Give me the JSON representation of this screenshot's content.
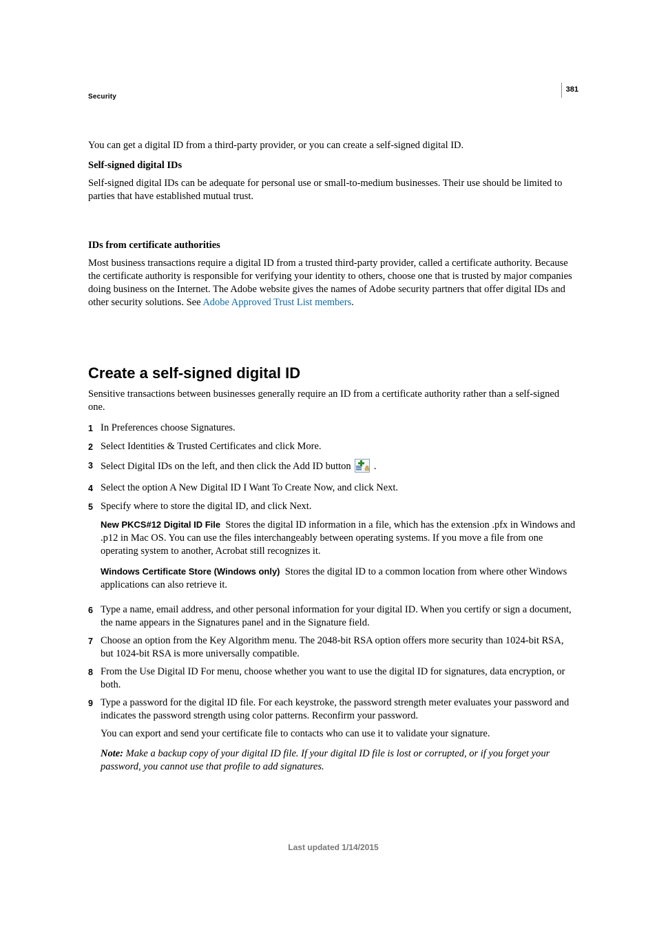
{
  "page_number": "381",
  "running_head": "Security",
  "intro_paragraph": "You can get a digital ID from a third-party provider, or you can create a self-signed digital ID.",
  "section_self_signed": {
    "title": "Self-signed digital IDs",
    "body": "Self-signed digital IDs can be adequate for personal use or small-to-medium businesses. Their use should be limited to parties that have established mutual trust."
  },
  "section_cert_auth": {
    "title": "IDs from certificate authorities",
    "body_before_link": "Most business transactions require a digital ID from a trusted third-party provider, called a certificate authority. Because the certificate authority is responsible for verifying your identity to others, choose one that is trusted by major companies doing business on the Internet. The Adobe website gives the names of Adobe security partners that offer digital IDs and other security solutions. See ",
    "link_text": "Adobe Approved Trust List members",
    "body_after_link": "."
  },
  "h2": "Create a self-signed digital ID",
  "h2_intro": "Sensitive transactions between businesses generally require an ID from a certificate authority rather than a self-signed one.",
  "steps": {
    "s1": "In Preferences choose Signatures.",
    "s2": "Select Identities & Trusted Certificates and click More.",
    "s3_before": "Select Digital IDs on the left, and then click the Add ID button ",
    "s3_after": " .",
    "s4": "Select the option A New Digital ID I Want To Create Now, and click Next.",
    "s5": "Specify where to store the digital ID, and click Next.",
    "s5_sub1_label": "New PKCS#12 Digital ID File",
    "s5_sub1_body": "Stores the digital ID information in a file, which has the extension .pfx in Windows and .p12 in Mac OS. You can use the files interchangeably between operating systems. If you move a file from one operating system to another, Acrobat still recognizes it.",
    "s5_sub2_label": "Windows Certificate Store (Windows only)",
    "s5_sub2_body": "Stores the digital ID to a common location from where other Windows applications can also retrieve it.",
    "s6": "Type a name, email address, and other personal information for your digital ID. When you certify or sign a document, the name appears in the Signatures panel and in the Signature field.",
    "s7": "Choose an option from the Key Algorithm menu. The 2048-bit RSA option offers more security than 1024-bit RSA, but 1024-bit RSA is more universally compatible.",
    "s8": "From the Use Digital ID For menu, choose whether you want to use the digital ID for signatures, data encryption, or both.",
    "s9": "Type a password for the digital ID file. For each keystroke, the password strength meter evaluates your password and indicates the password strength using color patterns. Reconfirm your password.",
    "s9_extra": "You can export and send your certificate file to contacts who can use it to validate your signature.",
    "s9_note_label": "Note: ",
    "s9_note_body": "Make a backup copy of your digital ID file. If your digital ID file is lost or corrupted, or if you forget your password, you cannot use that profile to add signatures."
  },
  "nums": {
    "n1": "1",
    "n2": "2",
    "n3": "3",
    "n4": "4",
    "n5": "5",
    "n6": "6",
    "n7": "7",
    "n8": "8",
    "n9": "9"
  },
  "footer": "Last updated 1/14/2015"
}
